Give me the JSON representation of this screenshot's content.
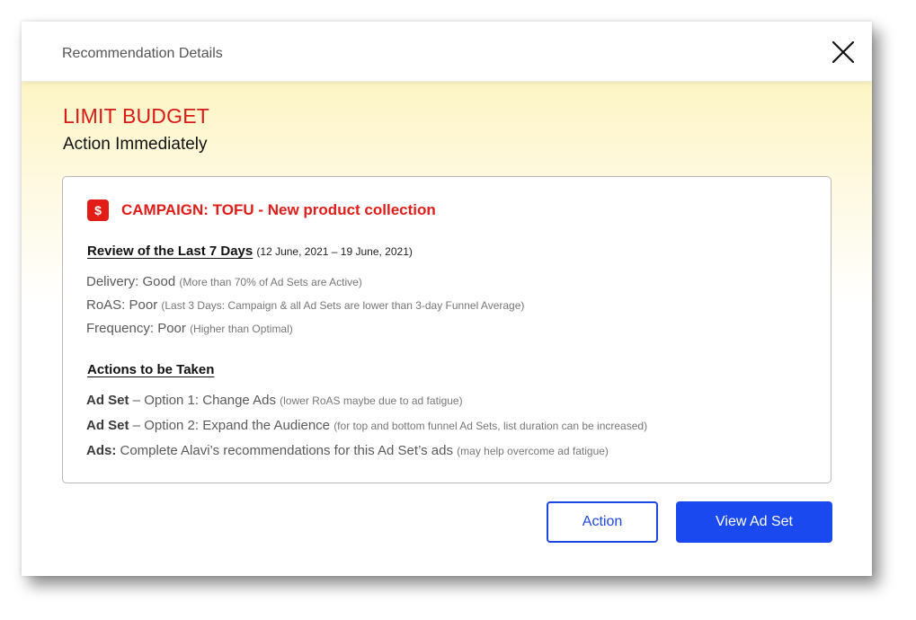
{
  "dialog": {
    "title": "Recommendation Details"
  },
  "recommendation": {
    "headline": "LIMIT BUDGET",
    "subheadline": "Action Immediately",
    "colors": {
      "alert_red": "#e01d18",
      "primary_blue": "#1b49f0",
      "band_yellow": "#fdf5c4"
    }
  },
  "card": {
    "badge_icon": "dollar-icon",
    "badge_symbol": "$",
    "campaign_title": "CAMPAIGN: TOFU - New product collection",
    "review": {
      "heading": "Review of the Last 7 Days",
      "date_range": "(12 June, 2021 – 19 June, 2021)",
      "metrics": [
        {
          "label": "Delivery: Good",
          "note": "(More than 70% of Ad Sets are Active)"
        },
        {
          "label": "RoAS: Poor",
          "note": "(Last 3 Days: Campaign & all Ad Sets are lower than 3-day Funnel Average)"
        },
        {
          "label": "Frequency: Poor",
          "note": "(Higher than Optimal)"
        }
      ]
    },
    "actions": {
      "heading": "Actions to be Taken",
      "items": [
        {
          "prefix": "Ad Set",
          "text": " – Option 1: Change Ads",
          "note": "(lower RoAS maybe due to ad fatigue)"
        },
        {
          "prefix": "Ad Set",
          "text": " – Option 2: Expand the Audience",
          "note": "(for top and bottom funnel Ad Sets, list duration can be increased)"
        },
        {
          "prefix": "Ads:",
          "text": " Complete Alavi’s recommendations for this Ad Set’s ads",
          "note": "(may help overcome ad fatigue)"
        }
      ]
    }
  },
  "buttons": {
    "action_label": "Action",
    "view_label": "View Ad Set"
  }
}
